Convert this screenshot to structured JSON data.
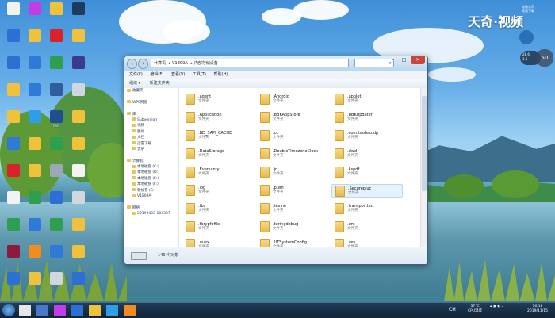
{
  "desktop": {
    "brand_text": "天奇·视频",
    "corner_text": [
      "电脑公司",
      "无需下载"
    ],
    "weather_bubble": [
      "28.6",
      "1.5"
    ],
    "percent_bubble": "50",
    "icons": [
      {
        "label": "",
        "color": "#f3f3f3"
      },
      {
        "label": "",
        "color": "#2e6fd6"
      },
      {
        "label": "",
        "color": "#2e6fd6"
      },
      {
        "label": "",
        "color": "#f0c23b"
      },
      {
        "label": "",
        "color": "#f0c23b"
      },
      {
        "label": "",
        "color": "#2e7ad6"
      },
      {
        "label": "",
        "color": "#d9222a"
      },
      {
        "label": "",
        "color": "#f3f3f3"
      },
      {
        "label": "",
        "color": "#2e9e4f"
      },
      {
        "label": "",
        "color": "#8d1b3d"
      },
      {
        "label": "",
        "color": "#2e6fd6"
      },
      {
        "label": "",
        "color": "#c23de8"
      },
      {
        "label": "",
        "color": "#f0c23b"
      },
      {
        "label": "",
        "color": "#2e7ad6"
      },
      {
        "label": "",
        "color": "#2e7ad6"
      },
      {
        "label": "",
        "color": "#2e9ee6"
      },
      {
        "label": "",
        "color": "#f0c23b"
      },
      {
        "label": "",
        "color": "#f0c23b"
      },
      {
        "label": "",
        "color": "#2e9e4f"
      },
      {
        "label": "",
        "color": "#2e7ad6"
      },
      {
        "label": "",
        "color": "#f28c1e"
      },
      {
        "label": "",
        "color": "#f0c23b"
      },
      {
        "label": "",
        "color": "#f0c23b"
      },
      {
        "label": "",
        "color": "#d9222a"
      },
      {
        "label": "",
        "color": "#2e9e4f"
      },
      {
        "label": "",
        "color": "#2e5e9e"
      },
      {
        "label": "CAD",
        "color": "#1f4f8f"
      },
      {
        "label": "",
        "color": "#2e9e4f"
      },
      {
        "label": "",
        "color": "#9aa7b5"
      },
      {
        "label": "",
        "color": "#2e6fd6"
      },
      {
        "label": "",
        "color": "#2e9e4f"
      },
      {
        "label": "",
        "color": "#2e7ad6"
      },
      {
        "label": "",
        "color": "#d0d7df"
      },
      {
        "label": "",
        "color": "#1f3a5f"
      },
      {
        "label": "",
        "color": "#f0c23b"
      },
      {
        "label": "",
        "color": "#3a3a8f"
      },
      {
        "label": "",
        "color": "#d0d7df"
      },
      {
        "label": "",
        "color": "#f0c23b"
      },
      {
        "label": "",
        "color": "#f0c23b"
      },
      {
        "label": "",
        "color": "#f3f3f3"
      },
      {
        "label": "",
        "color": "#d0d7df"
      },
      {
        "label": "",
        "color": "#f0c23b"
      },
      {
        "label": "",
        "color": "#f0c23b"
      },
      {
        "label": "",
        "color": "#2e6fd6"
      }
    ]
  },
  "window": {
    "address": [
      "计算机",
      "V1809A",
      "内部存储设备"
    ],
    "menu": [
      "文件(F)",
      "编辑(E)",
      "查看(V)",
      "工具(T)",
      "帮助(H)"
    ],
    "toolbar": [
      "组织 ▾",
      "新建文件夹"
    ],
    "nav": [
      {
        "label": "收藏夹"
      },
      {
        "label": ""
      },
      {
        "label": "WPS网盘"
      },
      {
        "label": ""
      },
      {
        "label": "库"
      },
      {
        "label": "Subversion"
      },
      {
        "label": "视频"
      },
      {
        "label": "图片"
      },
      {
        "label": "文档"
      },
      {
        "label": "迅雷下载"
      },
      {
        "label": "音乐"
      },
      {
        "label": ""
      },
      {
        "label": "计算机"
      },
      {
        "label": "本地磁盘 (C:)"
      },
      {
        "label": "本地磁盘 (D:)"
      },
      {
        "label": "本地磁盘 (E:)"
      },
      {
        "label": "本地磁盘 (F:)"
      },
      {
        "label": "新加卷 (G:)"
      },
      {
        "label": "V1809A"
      },
      {
        "label": ""
      },
      {
        "label": "网络"
      },
      {
        "label": "20190403-104337"
      }
    ],
    "type_label": "文件夹",
    "files": [
      ".agent",
      ".Android",
      ".applet",
      ".Application",
      ".BBKAppStore",
      ".BBKUpdater",
      ".BD_SAPI_CACHE",
      ".cc",
      ".com.taobao.dp",
      ".DataStorage",
      ".DoubleTimezoneClock",
      ".dwd",
      ".Eversanty",
      ".jr",
      ".kspdf",
      ".log",
      ".push",
      ".Securepluc",
      ".tbs",
      ".texine",
      ".transportted",
      ".tkrypfofile",
      ".turingdebug",
      ".um",
      ".uuex",
      ".UTSystemConfig",
      ".vex"
    ],
    "status_count": "146 个对象"
  },
  "taskbar": {
    "apps": [
      "#e7e7e7",
      "#4a78c8",
      "#c23de8",
      "#2e6fd6",
      "#f0c23b",
      "#2e9ee6",
      "#f28c1e"
    ],
    "tray_cpu": [
      "37°C",
      "CPU温度"
    ],
    "tray_lang": "CH",
    "time": "16:18",
    "date": "2019/11/15"
  }
}
